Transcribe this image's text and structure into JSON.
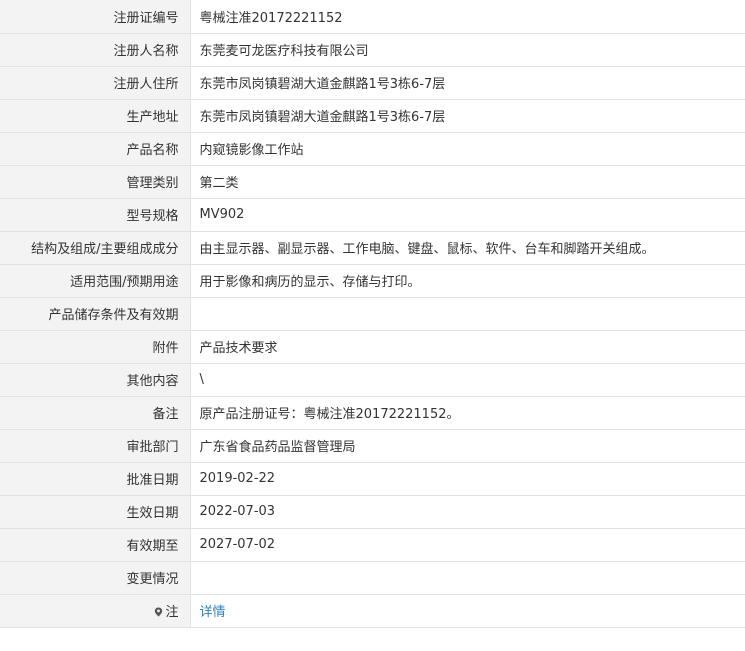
{
  "rows": [
    {
      "label": "注册证编号",
      "value": "粤械注准20172221152"
    },
    {
      "label": "注册人名称",
      "value": "东莞麦可龙医疗科技有限公司"
    },
    {
      "label": "注册人住所",
      "value": "东莞市凤岗镇碧湖大道金麒路1号3栋6-7层"
    },
    {
      "label": "生产地址",
      "value": "东莞市凤岗镇碧湖大道金麒路1号3栋6-7层"
    },
    {
      "label": "产品名称",
      "value": "内窥镜影像工作站"
    },
    {
      "label": "管理类别",
      "value": "第二类"
    },
    {
      "label": "型号规格",
      "value": "MV902"
    },
    {
      "label": "结构及组成/主要组成成分",
      "value": "由主显示器、副显示器、工作电脑、键盘、鼠标、软件、台车和脚踏开关组成。"
    },
    {
      "label": "适用范围/预期用途",
      "value": "用于影像和病历的显示、存储与打印。"
    },
    {
      "label": "产品储存条件及有效期",
      "value": ""
    },
    {
      "label": "附件",
      "value": "产品技术要求"
    },
    {
      "label": "其他内容",
      "value": "\\"
    },
    {
      "label": "备注",
      "value": "原产品注册证号：粤械注准20172221152。"
    },
    {
      "label": "审批部门",
      "value": "广东省食品药品监督管理局"
    },
    {
      "label": "批准日期",
      "value": "2019-02-22"
    },
    {
      "label": "生效日期",
      "value": "2022-07-03"
    },
    {
      "label": "有效期至",
      "value": "2027-07-02"
    },
    {
      "label": "变更情况",
      "value": ""
    }
  ],
  "note_row": {
    "label": "注",
    "link_text": "详情",
    "icon": "pin-icon"
  },
  "colors": {
    "label_bg": "#f3f3f3",
    "border": "#e2e2e2",
    "link": "#2f7fc1"
  }
}
